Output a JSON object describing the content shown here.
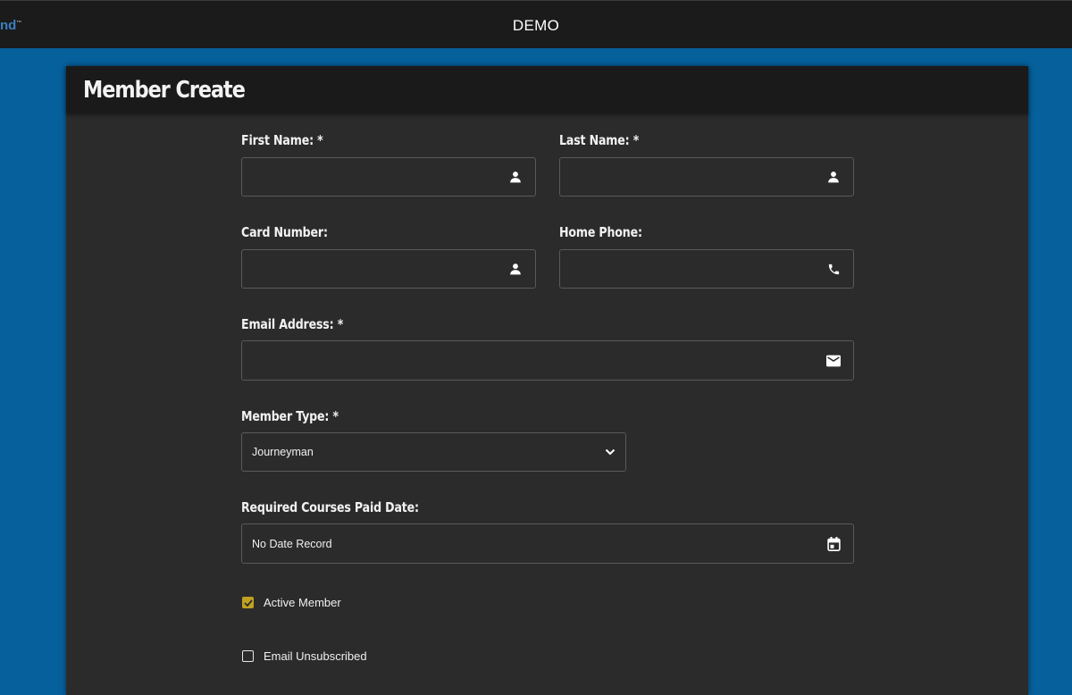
{
  "header": {
    "brand_fragment": "nd",
    "brand_mark": "™",
    "app_title": "DEMO"
  },
  "panel": {
    "title": "Member Create"
  },
  "form": {
    "first_name": {
      "label": "First Name: *",
      "value": "",
      "icon": "person-icon"
    },
    "last_name": {
      "label": "Last Name: *",
      "value": "",
      "icon": "person-icon"
    },
    "card_number": {
      "label": "Card Number:",
      "value": "",
      "icon": "person-icon"
    },
    "home_phone": {
      "label": "Home Phone:",
      "value": "",
      "icon": "phone-icon"
    },
    "email": {
      "label": "Email Address: *",
      "value": "",
      "icon": "mail-icon"
    },
    "member_type": {
      "label": "Member Type: *",
      "selected": "Journeyman",
      "icon": "chevron-down-icon"
    },
    "paid_date": {
      "label": "Required Courses Paid Date:",
      "value": "No Date Record",
      "icon": "calendar-icon"
    },
    "active_member": {
      "label": "Active Member",
      "checked": true
    },
    "email_unsubscribed": {
      "label": "Email Unsubscribed",
      "checked": false
    }
  },
  "colors": {
    "background": "#06609c",
    "topbar": "#1b1b1b",
    "panel": "#2b2b2b",
    "panel_header": "#1a1a1a",
    "checkbox_accent": "#c2a022"
  }
}
